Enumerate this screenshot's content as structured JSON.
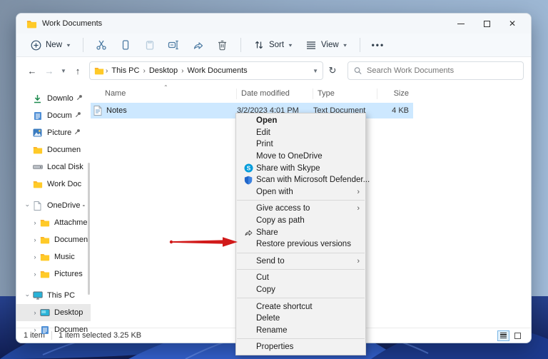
{
  "window": {
    "title": "Work Documents",
    "controls": {
      "minimize": "minimize",
      "maximize": "maximize",
      "close": "✕"
    }
  },
  "toolbar": {
    "new_label": "New",
    "sort_label": "Sort",
    "view_label": "View",
    "more_label": "•••"
  },
  "address": {
    "breadcrumb": [
      "This PC",
      "Desktop",
      "Work Documents"
    ],
    "search_placeholder": "Search Work Documents"
  },
  "sidebar": {
    "items": [
      {
        "label": "Downlo",
        "icon": "download-icon",
        "pinned": true
      },
      {
        "label": "Docum",
        "icon": "document-icon",
        "pinned": true
      },
      {
        "label": "Picture",
        "icon": "picture-icon",
        "pinned": true
      },
      {
        "label": "Documen",
        "icon": "folder-icon"
      },
      {
        "label": "Local Disk",
        "icon": "drive-icon"
      },
      {
        "label": "Work Doc",
        "icon": "folder-icon"
      },
      {
        "label": "OneDrive -",
        "icon": "onedrive-icon",
        "expand": "open"
      },
      {
        "label": "Attachme",
        "icon": "folder-icon",
        "expand": "closed",
        "indent": 1
      },
      {
        "label": "Documen",
        "icon": "folder-icon",
        "expand": "closed",
        "indent": 1
      },
      {
        "label": "Music",
        "icon": "folder-icon",
        "expand": "closed",
        "indent": 1
      },
      {
        "label": "Pictures",
        "icon": "folder-icon",
        "expand": "closed",
        "indent": 1
      },
      {
        "label": "This PC",
        "icon": "computer-icon",
        "expand": "open"
      },
      {
        "label": "Desktop",
        "icon": "desktop-icon",
        "expand": "closed",
        "indent": 1,
        "selected": true
      },
      {
        "label": "Documen",
        "icon": "document-icon",
        "expand": "closed",
        "indent": 1
      }
    ]
  },
  "filelist": {
    "columns": [
      "Name",
      "Date modified",
      "Type",
      "Size"
    ],
    "rows": [
      {
        "name": "Notes",
        "date_modified": "3/2/2023 4:01 PM",
        "type": "Text Document",
        "size": "4 KB",
        "selected": true
      }
    ]
  },
  "context_menu": {
    "items": [
      {
        "label": "Open",
        "bold": true
      },
      {
        "label": "Edit"
      },
      {
        "label": "Print"
      },
      {
        "label": "Move to OneDrive"
      },
      {
        "label": "Share with Skype",
        "icon": "skype-icon"
      },
      {
        "label": "Scan with Microsoft Defender...",
        "icon": "defender-icon"
      },
      {
        "label": "Open with",
        "submenu": true
      },
      {
        "label": "Give access to",
        "submenu": true
      },
      {
        "label": "Copy as path"
      },
      {
        "label": "Share",
        "icon": "share-icon"
      },
      {
        "label": "Restore previous versions"
      },
      {
        "label": "Send to",
        "submenu": true
      },
      {
        "label": "Cut"
      },
      {
        "label": "Copy"
      },
      {
        "label": "Create shortcut"
      },
      {
        "label": "Delete"
      },
      {
        "label": "Rename"
      },
      {
        "label": "Properties"
      }
    ],
    "submenu_arrow": "›"
  },
  "statusbar": {
    "item_count": "1 item",
    "selection": "1 item selected  3.25 KB"
  },
  "annotation": {
    "arrow_color": "#d11a1a",
    "target": "Restore previous versions"
  },
  "colors": {
    "selection_row": "#cde8ff",
    "menu_background": "#f2f2f2",
    "accent": "#0078d4",
    "folder_yellow": "#ffca28"
  }
}
